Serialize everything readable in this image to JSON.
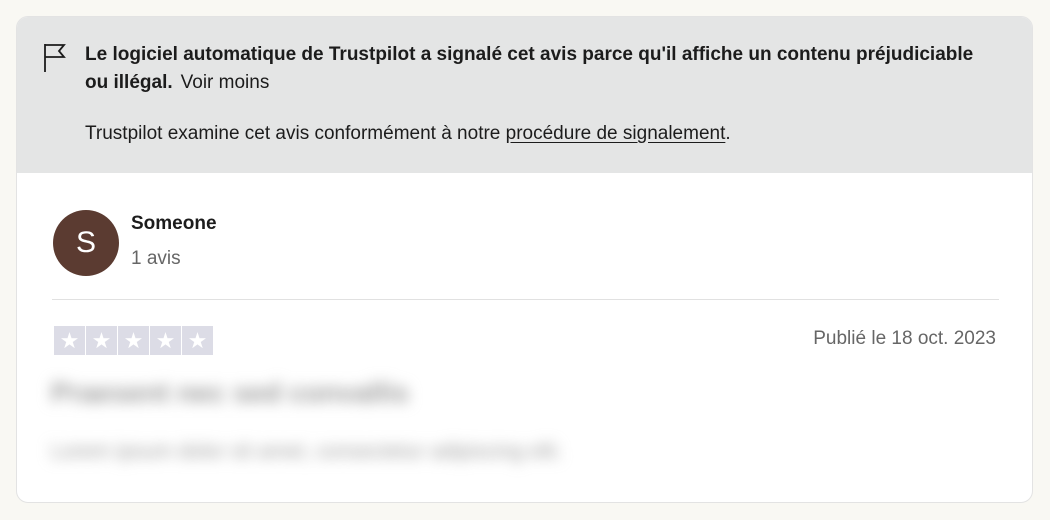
{
  "notice": {
    "icon": "flag-icon",
    "message_bold": "Le logiciel automatique de Trustpilot a signalé cet avis parce qu'il affiche un contenu préjudiciable ou illégal.",
    "show_less": "Voir moins",
    "examine_text": "Trustpilot examine cet avis conformément à notre ",
    "procedure_link": "procédure de signalement",
    "period": "."
  },
  "reviewer": {
    "initial": "S",
    "avatar_color": "#5b3b31",
    "name": "Someone",
    "review_count": "1 avis"
  },
  "review": {
    "rating": 0,
    "stars": 5,
    "published": "Publié le 18 oct. 2023",
    "blurred_title": "Praesent nec sed convallis",
    "blurred_body": "Lorem ipsum dolor sit amet, consectetur adipiscing elit."
  },
  "colors": {
    "notice_bg": "#e4e5e5",
    "star_empty": "#dcdce6"
  }
}
